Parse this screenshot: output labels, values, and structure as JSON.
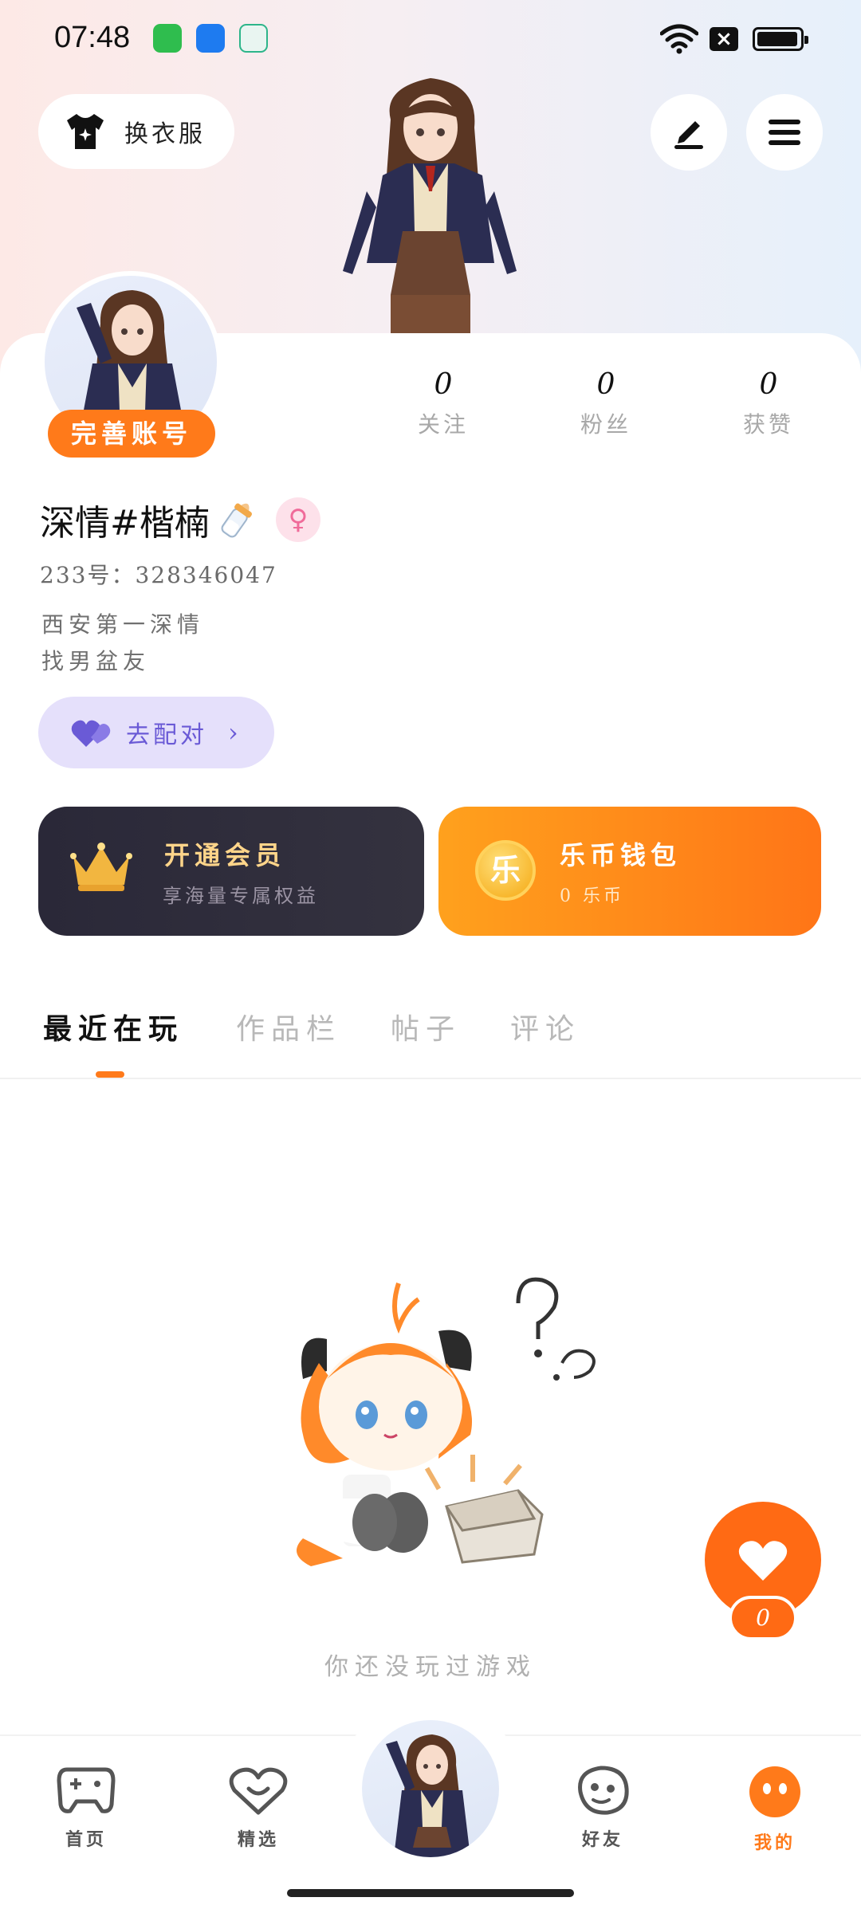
{
  "status_bar": {
    "time": "07:48"
  },
  "header": {
    "outfit_label": "换衣服"
  },
  "stats": [
    {
      "value": "0",
      "label": "关注"
    },
    {
      "value": "0",
      "label": "粉丝"
    },
    {
      "value": "0",
      "label": "获赞"
    }
  ],
  "profile": {
    "complete_label": "完善账号",
    "nickname": "深情#楷楠",
    "gender_symbol": "♀",
    "uid": "233号：328346047",
    "bio_line1": "西安第一深情",
    "bio_line2": "找男盆友",
    "pair_label": "去配对"
  },
  "cards": {
    "vip_title": "开通会员",
    "vip_sub": "享海量专属权益",
    "wallet_icon": "乐",
    "wallet_title": "乐币钱包",
    "wallet_sub": "0 乐币"
  },
  "tabs": [
    "最近在玩",
    "作品栏",
    "帖子",
    "评论"
  ],
  "empty": {
    "text": "你还没玩过游戏"
  },
  "like": {
    "count": "0"
  },
  "nav": [
    {
      "label": "首页"
    },
    {
      "label": "精选"
    },
    {
      "label": "好友"
    },
    {
      "label": "我的"
    }
  ],
  "colors": {
    "accent": "#ff7a1a",
    "pair": "#6a5ad6",
    "vip_gold": "#ffd58a"
  }
}
